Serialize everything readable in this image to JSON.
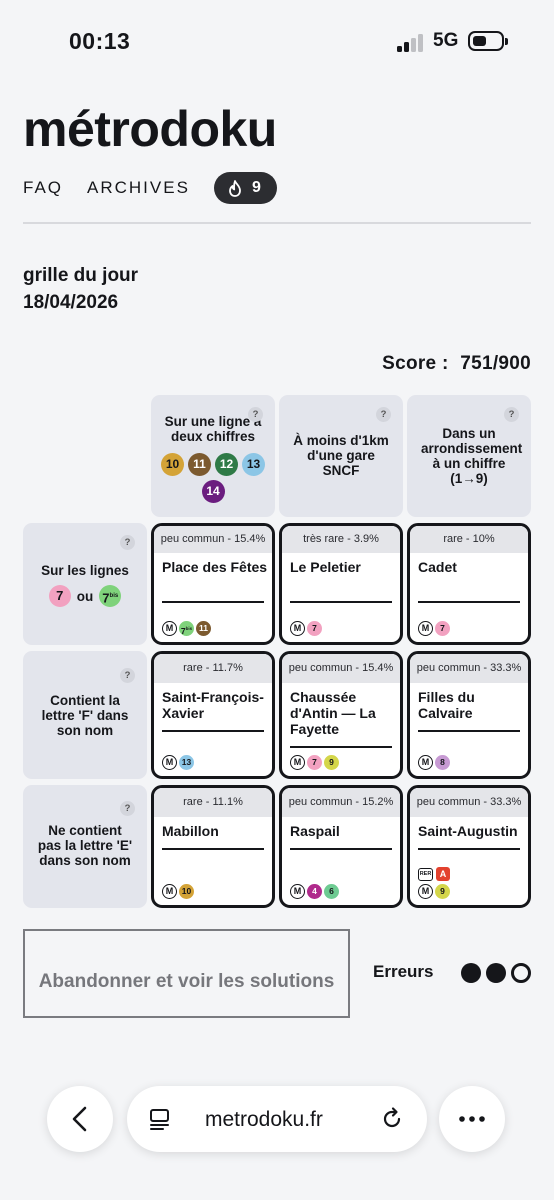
{
  "status_bar": {
    "time": "00:13",
    "network": "5G"
  },
  "header": {
    "logo": "métrodoku",
    "nav": [
      "FAQ",
      "ARCHIVES"
    ],
    "streak_count": "9"
  },
  "day": {
    "title": "grille du jour",
    "date": "18/04/2026"
  },
  "score": {
    "label": "Score :",
    "value": "751/900"
  },
  "columns": [
    {
      "text": "Sur une ligne à deux chiffres",
      "badges": [
        "10",
        "11",
        "12",
        "13",
        "14"
      ]
    },
    {
      "text": "À moins d'1km d'une gare SNCF"
    },
    {
      "text": "Dans un arrondissement à un chiffre (1→9)"
    }
  ],
  "rows": [
    {
      "text": "Sur les lignes",
      "or": "ou",
      "badges": [
        "7",
        "7bis"
      ]
    },
    {
      "text": "Contient la lettre 'F' dans son nom"
    },
    {
      "text": "Ne contient pas la lettre 'E' dans son nom"
    }
  ],
  "cells": [
    [
      {
        "rarity": "peu commun - 15.4%",
        "name": "Place des Fêtes",
        "lines": [
          "7bis",
          "11"
        ]
      },
      {
        "rarity": "très rare - 3.9%",
        "name": "Le Peletier",
        "lines": [
          "7"
        ]
      },
      {
        "rarity": "rare - 10%",
        "name": "Cadet",
        "lines": [
          "7"
        ]
      }
    ],
    [
      {
        "rarity": "rare - 11.7%",
        "name": "Saint-François-Xavier",
        "lines": [
          "13"
        ]
      },
      {
        "rarity": "peu commun - 15.4%",
        "name": "Chaussée d'Antin — La Fayette",
        "lines": [
          "7",
          "9"
        ]
      },
      {
        "rarity": "peu commun - 33.3%",
        "name": "Filles du Calvaire",
        "lines": [
          "8"
        ]
      }
    ],
    [
      {
        "rarity": "rare - 11.1%",
        "name": "Mabillon",
        "lines": [
          "10"
        ]
      },
      {
        "rarity": "peu commun - 15.2%",
        "name": "Raspail",
        "lines": [
          "4",
          "6"
        ]
      },
      {
        "rarity": "peu commun - 33.3%",
        "name": "Saint-Augustin",
        "lines": [
          "9"
        ],
        "rer": "A"
      }
    ]
  ],
  "metro_icon": "M",
  "rer_label": "RER",
  "give_up": "Abandonner et voir les solutions",
  "errors": {
    "label": "Erreurs",
    "used": 2,
    "total": 3
  },
  "browser": {
    "url": "metrodoku.fr"
  },
  "colors": {
    "l4": "#b02a8c",
    "l6": "#6ecb92",
    "l7": "#f2a1c0",
    "l7bis": "#7fd27b",
    "l8": "#c79ad3",
    "l9": "#d4d64a",
    "l10": "#d4a337",
    "l11": "#7c5a2f",
    "l12": "#2f7a47",
    "l13": "#8cc6e6",
    "l14": "#6b1d7f",
    "rerA": "#e3412e"
  }
}
